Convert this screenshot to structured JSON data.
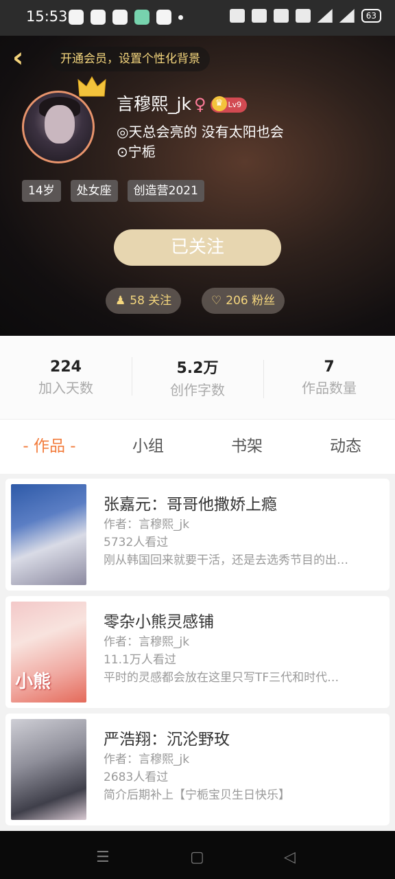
{
  "status_bar": {
    "time": "15:53",
    "battery": "63"
  },
  "header": {
    "promo": "开通会员，设置个性化背景",
    "name": "言穆熙_jk",
    "gender_symbol": "♀",
    "level": "Lv9",
    "signature": "◎天总会亮的 没有太阳也会",
    "location": "⊙宁栀",
    "tags": [
      "14岁",
      "处女座",
      "创造营2021"
    ],
    "follow_button": "已关注",
    "following": "58 关注",
    "fans": "206 粉丝",
    "accent_color": "#f5d77e"
  },
  "stats": [
    {
      "value": "224",
      "label": "加入天数"
    },
    {
      "value": "5.2万",
      "label": "创作字数"
    },
    {
      "value": "7",
      "label": "作品数量"
    }
  ],
  "tabs": [
    "- 作品 -",
    "小组",
    "书架",
    "动态"
  ],
  "works": [
    {
      "title": "张嘉元：哥哥他撒娇上瘾",
      "author": "作者：言穆熙_jk",
      "views": "5732人看过",
      "desc": "刚从韩国回来就要干活，还是去选秀节目的出…",
      "cover_text": ""
    },
    {
      "title": "零杂小熊灵感铺",
      "author": "作者：言穆熙_jk",
      "views": "11.1万人看过",
      "desc": "平时的灵感都会放在这里只写TF三代和时代…",
      "cover_text": "小熊"
    },
    {
      "title": "严浩翔：沉沦野玫",
      "author": "作者：言穆熙_jk",
      "views": "2683人看过",
      "desc": "简介后期补上【宁栀宝贝生日快乐】",
      "cover_text": ""
    }
  ]
}
